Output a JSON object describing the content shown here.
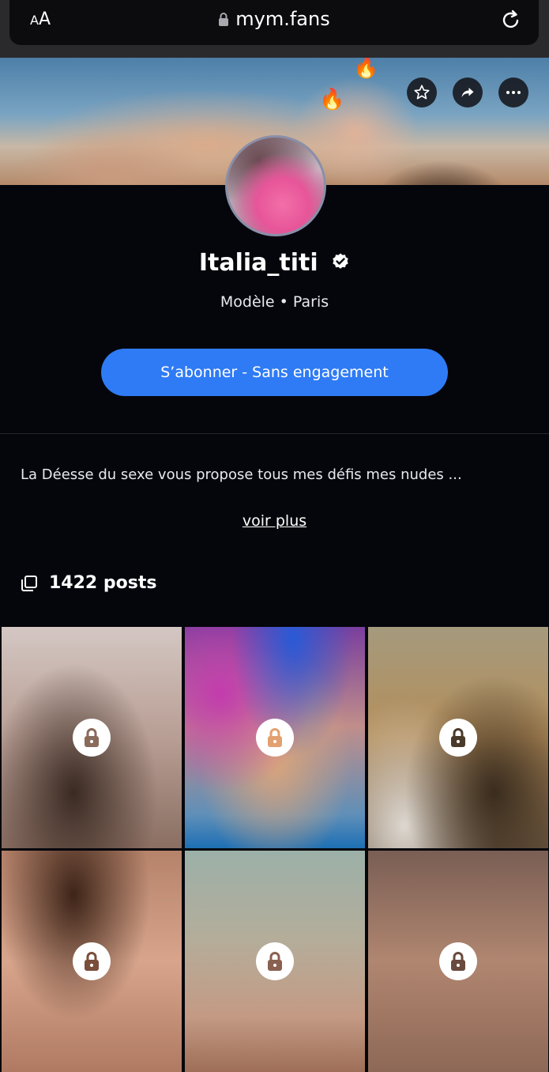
{
  "browser": {
    "text_size_label_small": "A",
    "text_size_label_large": "A",
    "url": "mym.fans"
  },
  "cover": {
    "actions": [
      "favorite",
      "share",
      "more"
    ]
  },
  "profile": {
    "name": "Italia_titi",
    "subtitle": "Modèle • Paris",
    "subscribe_label": "S’abonner - Sans engagement",
    "bio": "La Déesse du sexe vous propose tous mes défis mes nudes ...",
    "more_label": "voir plus",
    "posts_count_label": "1422 posts"
  },
  "colors": {
    "accent": "#2f7bf5",
    "background": "#05060c"
  },
  "icons": [
    "lock-icon",
    "reload-icon",
    "star-icon",
    "share-icon",
    "more-icon",
    "verified-icon",
    "posts-icon",
    "fire-icon"
  ]
}
